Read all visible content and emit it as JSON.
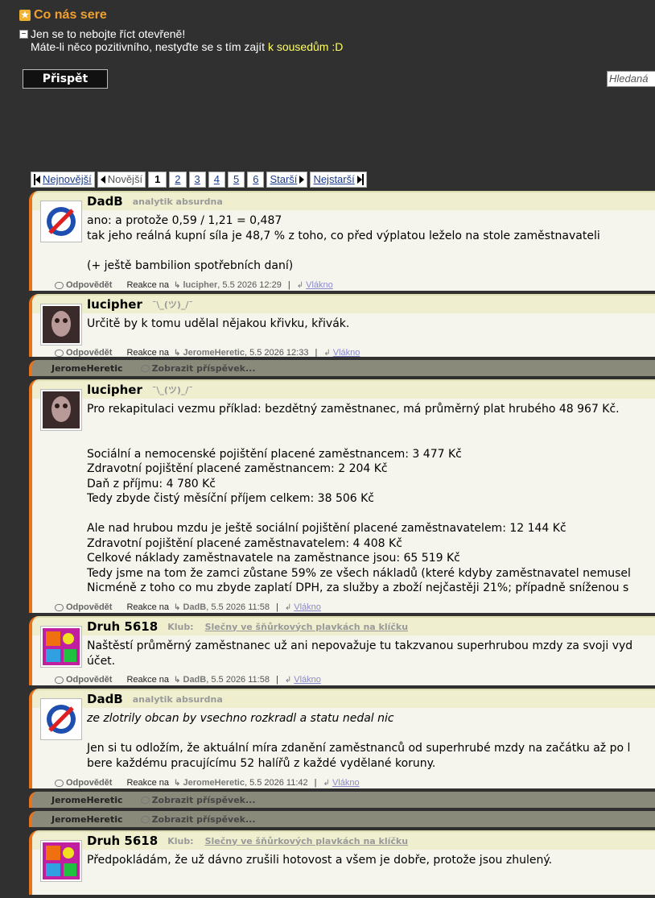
{
  "header": {
    "title": "Co nás sere",
    "desc_line1": "Jen se to nebojte říct otevřeně!",
    "desc_line2_prefix": "Máte-li něco pozitivního, nestyďte se s tím zajít ",
    "desc_link": "k sousedům :D"
  },
  "actions": {
    "post_button": "Přispět",
    "search_placeholder": "Hledaná"
  },
  "pager": {
    "newest": "Nejnovější",
    "newer": "Novější",
    "current": "1",
    "pages": [
      "2",
      "3",
      "4",
      "5",
      "6"
    ],
    "older": "Starší",
    "oldest": "Nejstarší"
  },
  "labels": {
    "reply": "Odpovědět",
    "reacts_to": "Reakce na",
    "thread": "Vlákno",
    "show_post": "Zobrazit příspěvek...",
    "klub": "Klub:"
  },
  "posts": [
    {
      "author": "DadB",
      "tag": "analytik absurdna",
      "body": "ano: a protože 0,59 / 1,21 = 0,487\ntak jeho reálná kupní síla je 48,7 % z toho, co před výplatou leželo na stole zaměstnavateli\n\n(+ ještě bambilion spotřebních daní)",
      "reply_to": "lucipher",
      "date": "5.5 2026 12:29"
    },
    {
      "author": "lucipher",
      "tag": "¯\\_(ツ)_/¯",
      "body": "Určitě by k tomu udělal nějakou křivku, křivák.",
      "reply_to": "JeromeHeretic",
      "date": "5.5 2026 12:33"
    },
    {
      "hidden_author": "JeromeHeretic"
    },
    {
      "author": "lucipher",
      "tag": "¯\\_(ツ)_/¯",
      "body": "Pro rekapitulaci vezmu příklad: bezdětný zaměstnanec, má průměrný plat hrubého 48 967 Kč.\n\n\nSociální a nemocenské pojištění placené zaměstnancem: 3 477 Kč\nZdravotní pojištění placené zaměstnancem: 2 204 Kč\nDaň z příjmu: 4 780 Kč\nTedy zbyde čistý měsíční příjem celkem: 38 506 Kč\n\nAle nad hrubou mzdu je ještě sociální pojištění placené zaměstnavatelem: 12 144 Kč\nZdravotní pojištění placené zaměstnavatelem: 4 408 Kč\nCelkové náklady zaměstnavatele na zaměstnance jsou: 65 519 Kč\nTedy jsme na tom že zamci zůstane 59% ze všech nákladů (které kdyby zaměstnavatel nemusel\nNicméně z toho co mu zbyde zaplatí DPH, za služby a zboží nejčastěji 21%; případně sníženou s",
      "reply_to": "DadB",
      "date": "5.5 2026 11:58"
    },
    {
      "author": "Druh 5618",
      "klub_name": "Slečny ve šňůrkových plavkách na klíčku",
      "body": "Naštěstí průměrný zaměstnanec už ani nepovažuje tu takzvanou superhrubou mzdy za svoji vyd\núčet.",
      "reply_to": "DadB",
      "date": "5.5 2026 11:58"
    },
    {
      "author": "DadB",
      "tag": "analytik absurdna",
      "quote": "ze zlotrily obcan by vsechno rozkradl a statu nedal nic",
      "body": "Jen si tu odložím, že aktuální míra zdanění zaměstnanců od superhrubé mzdy na začátku až po l\nbere každému pracujícímu 52 halířů z každé vydělané koruny.",
      "reply_to": "JeromeHeretic",
      "date": "5.5 2026 11:42"
    },
    {
      "hidden_author": "JeromeHeretic"
    },
    {
      "hidden_author": "JeromeHeretic"
    },
    {
      "author": "Druh 5618",
      "klub_name": "Slečny ve šňůrkových plavkách na klíčku",
      "body": "Předpokládám, že už dávno zrušili hotovost a všem je dobře, protože jsou zhulený."
    }
  ]
}
